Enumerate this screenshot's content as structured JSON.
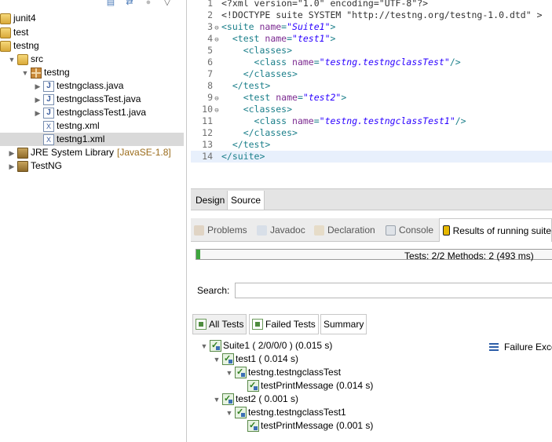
{
  "explorer": {
    "items": [
      {
        "label": "junit4",
        "icon": "project-icon"
      },
      {
        "label": "test",
        "icon": "project-icon"
      },
      {
        "label": "testng",
        "icon": "project-icon"
      },
      {
        "label": "src",
        "icon": "source-folder-icon"
      },
      {
        "label": "testng",
        "icon": "package-icon"
      },
      {
        "label": "testngclass.java",
        "icon": "java-file-icon"
      },
      {
        "label": "testngclassTest.java",
        "icon": "java-file-icon"
      },
      {
        "label": "testngclassTest1.java",
        "icon": "java-file-icon"
      },
      {
        "label": "testng.xml",
        "icon": "xml-file-icon"
      },
      {
        "label": "testng1.xml",
        "icon": "xml-file-icon"
      },
      {
        "label": "JRE System Library",
        "version": "[JavaSE-1.8]",
        "icon": "library-icon"
      },
      {
        "label": "TestNG",
        "icon": "library-icon"
      }
    ]
  },
  "editor": {
    "lines": [
      {
        "num": "1",
        "text": "<?xml version=\"1.0\" encoding=\"UTF-8\"?>"
      },
      {
        "num": "2",
        "text": "<!DOCTYPE suite SYSTEM \"http://testng.org/testng-1.0.dtd\" >"
      },
      {
        "num": "3",
        "tag_open": "<suite ",
        "attr": "name",
        "eq": "=",
        "val": "\"Suite1\"",
        "close": ">"
      },
      {
        "num": "4",
        "tag_open": "  <test ",
        "attr": "name",
        "eq": "=",
        "val": "\"test1\"",
        "close": ">"
      },
      {
        "num": "5",
        "text": "    <classes>"
      },
      {
        "num": "6",
        "tag_open": "      <class ",
        "attr": "name",
        "eq": "=",
        "val": "\"testng.testngclassTest\"",
        "close": "/>"
      },
      {
        "num": "7",
        "text": "    </classes>"
      },
      {
        "num": "8",
        "text": "  </test>"
      },
      {
        "num": "9",
        "tag_open": "    <test ",
        "attr": "name",
        "eq": "=",
        "val": "\"test2\"",
        "close": ">"
      },
      {
        "num": "10",
        "text": "    <classes>"
      },
      {
        "num": "11",
        "tag_open": "      <class ",
        "attr": "name",
        "eq": "=",
        "val": "\"testng.testngclassTest1\"",
        "close": "/>"
      },
      {
        "num": "12",
        "text": "    </classes>"
      },
      {
        "num": "13",
        "text": "  </test>"
      },
      {
        "num": "14",
        "text": "</suite>"
      }
    ]
  },
  "editor_tabs": {
    "design": "Design",
    "source": "Source"
  },
  "view_tabs": {
    "problems": "Problems",
    "javadoc": "Javadoc",
    "declaration": "Declaration",
    "console": "Console",
    "results": "Results of running suite"
  },
  "results": {
    "progress": 0.01,
    "stats": "Tests: 2/2  Methods: 2 (493 ms)",
    "search_label": "Search:",
    "search_value": "",
    "tabs": {
      "all": "All Tests",
      "failed": "Failed Tests",
      "summary": "Summary"
    },
    "tree": [
      {
        "label": "Suite1 ( 2/0/0/0 ) (0.015 s)"
      },
      {
        "label": "test1 ( 0.014 s)"
      },
      {
        "label": "testng.testngclassTest"
      },
      {
        "label": "testPrintMessage  (0.014 s)"
      },
      {
        "label": "test2 ( 0.001 s)"
      },
      {
        "label": "testng.testngclassTest1"
      },
      {
        "label": "testPrintMessage  (0.001 s)"
      }
    ],
    "failure_label": "Failure Exce"
  },
  "colors": {
    "pass": "#3ea63e",
    "tag": "#1b7f8a",
    "attr": "#7c2b91",
    "value": "#2a00ff"
  }
}
